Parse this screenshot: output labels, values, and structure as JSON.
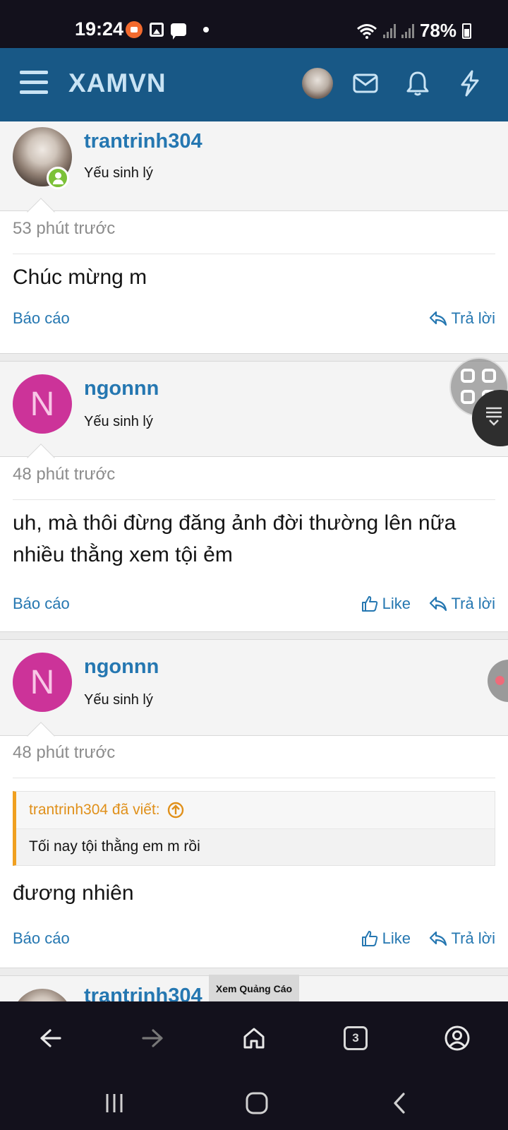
{
  "status_bar": {
    "time": "19:24",
    "battery": "78%"
  },
  "header": {
    "logo": "XAMVN"
  },
  "posts": [
    {
      "username": "trantrinh304",
      "user_title": "Yếu sinh lý",
      "time": "53 phút trước",
      "content": "Chúc mừng m",
      "report_label": "Báo cáo",
      "reply_label": "Trả lời"
    },
    {
      "avatar_letter": "N",
      "username": "ngonnn",
      "user_title": "Yếu sinh lý",
      "time": "48 phút trước",
      "content": "uh, mà thôi đừng đăng ảnh đời thường lên nữa nhiều thằng xem tội ẻm",
      "report_label": "Báo cáo",
      "like_label": "Like",
      "reply_label": "Trả lời"
    },
    {
      "avatar_letter": "N",
      "username": "ngonnn",
      "user_title": "Yếu sinh lý",
      "time": "48 phút trước",
      "quote_author": "trantrinh304 đã viết:",
      "quote_text": "Tối nay tội thằng em m rồi",
      "content": "đương nhiên",
      "report_label": "Báo cáo",
      "like_label": "Like",
      "reply_label": "Trả lời"
    },
    {
      "username": "trantrinh304"
    }
  ],
  "ad": {
    "label": "Xem Quảng Cáo"
  },
  "browser_bar": {
    "tab_count": "3"
  },
  "colors": {
    "header_bg": "#185886",
    "link": "#2577b1",
    "quote_accent": "#f0a020",
    "avatar_letter_bg": "#cc3399"
  }
}
